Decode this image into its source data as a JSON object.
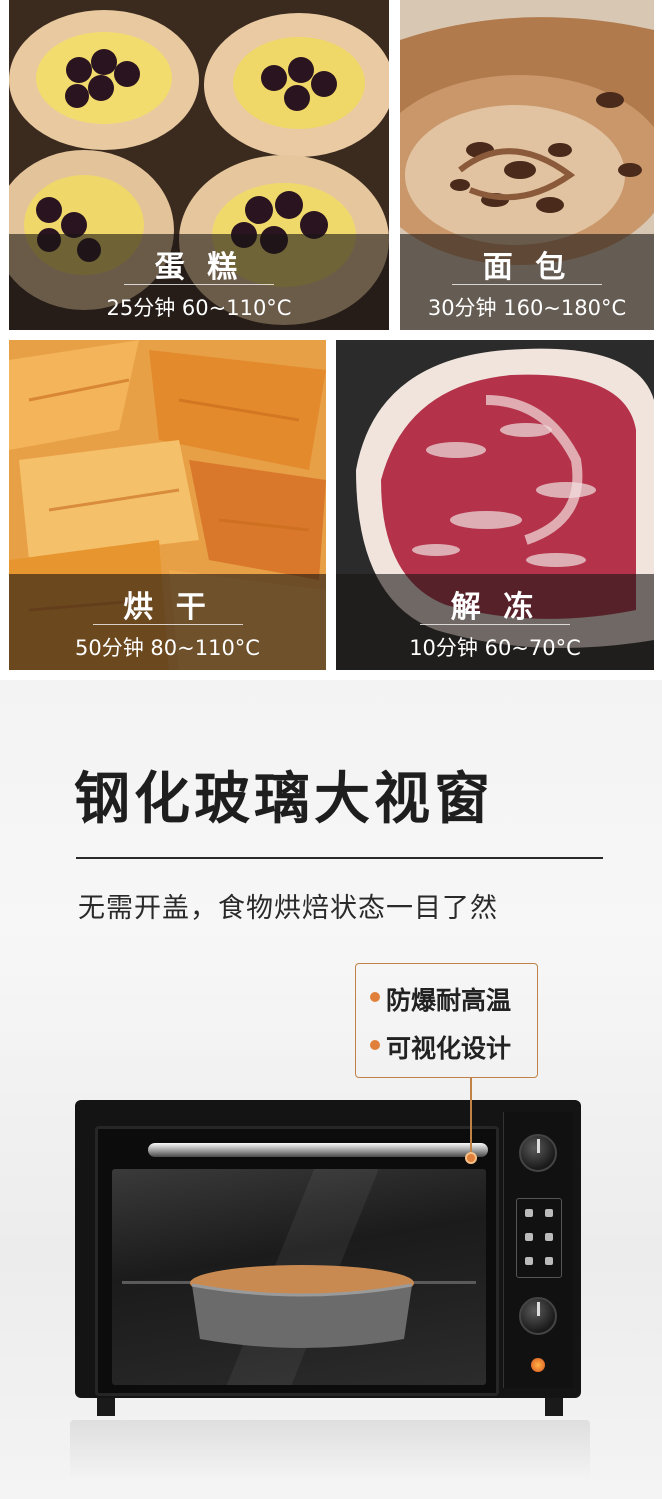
{
  "food_tiles": [
    {
      "name": "蛋 糕",
      "info": "25分钟  60~110°C"
    },
    {
      "name": "面 包",
      "info": "30分钟  160~180°C"
    },
    {
      "name": "烘 干",
      "info": "50分钟  80~110°C"
    },
    {
      "name": "解 冻",
      "info": "10分钟  60~70°C"
    }
  ],
  "glass_section": {
    "headline": "钢化玻璃大视窗",
    "subline": "无需开盖，食物烘焙状态一目了然",
    "features": [
      "防爆耐高温",
      "可视化设计"
    ]
  },
  "colors": {
    "accent": "#e0803a",
    "caption_bg": "#191614"
  }
}
